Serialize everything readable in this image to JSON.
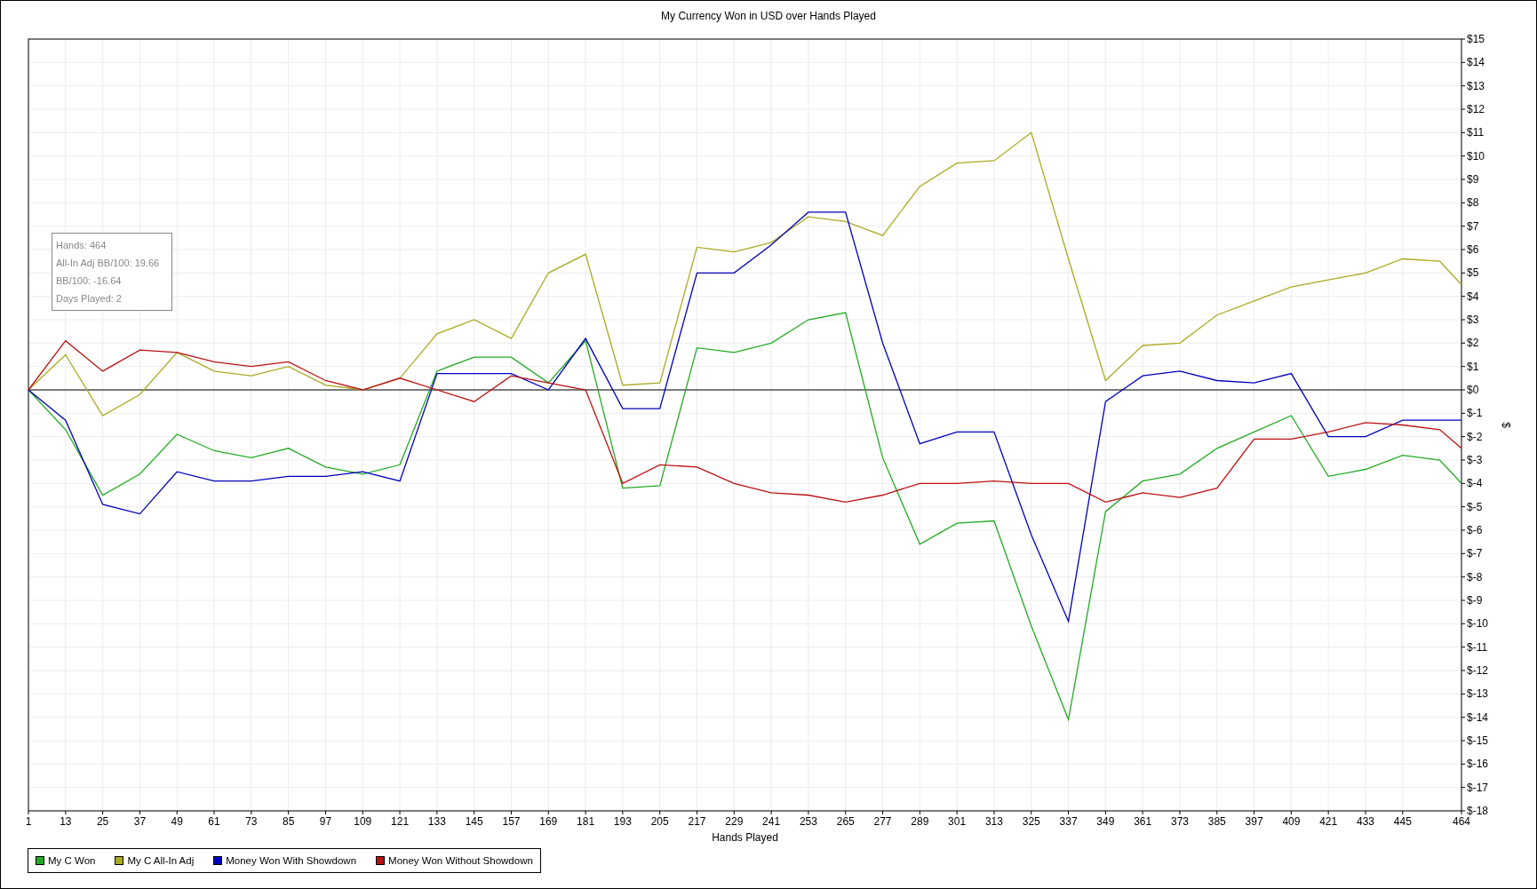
{
  "chart": {
    "stats": [
      "Hands: 464",
      "All-In Adj BB/100: 19.66",
      "BB/100: -16.64",
      "Days Played: 2"
    ],
    "chart_data": {
      "type": "line",
      "title": "My Currency Won in USD over Hands Played",
      "xlabel": "Hands Played",
      "ylabel": "$",
      "x": [
        1,
        13,
        25,
        37,
        49,
        61,
        73,
        85,
        97,
        109,
        121,
        133,
        145,
        157,
        169,
        181,
        193,
        205,
        217,
        229,
        241,
        253,
        265,
        277,
        289,
        301,
        313,
        325,
        337,
        349,
        361,
        373,
        385,
        397,
        409,
        421,
        433,
        445,
        457,
        464
      ],
      "series": [
        {
          "name": "My C Won",
          "color": "#22aa22",
          "values": [
            0,
            -1.7,
            -4.5,
            -3.6,
            -1.9,
            -2.6,
            -2.9,
            -2.5,
            -3.3,
            -3.6,
            -3.2,
            0.8,
            1.4,
            1.4,
            0.3,
            2.1,
            -4.2,
            -4.1,
            1.8,
            1.6,
            2.0,
            3.0,
            3.3,
            -2.9,
            -6.6,
            -5.7,
            -5.6,
            -10.1,
            -14.1,
            -5.2,
            -3.9,
            -3.6,
            -2.5,
            -1.8,
            -1.1,
            -3.7,
            -3.4,
            -2.8,
            -3.0,
            -4.0
          ]
        },
        {
          "name": "My C All-In Adj",
          "color": "#aaaa22",
          "values": [
            0,
            1.5,
            -1.1,
            -0.2,
            1.6,
            0.8,
            0.6,
            1.0,
            0.2,
            0,
            0.5,
            2.4,
            3.0,
            2.2,
            5.0,
            5.8,
            0.2,
            0.3,
            6.1,
            5.9,
            6.3,
            7.4,
            7.2,
            6.6,
            8.7,
            9.7,
            9.8,
            11.0,
            5.6,
            0.4,
            1.9,
            2.0,
            3.2,
            3.8,
            4.4,
            4.7,
            5.0,
            5.6,
            5.5,
            4.5
          ]
        },
        {
          "name": "Money Won With Showdown",
          "color": "#0000bb",
          "values": [
            0,
            -1.3,
            -4.9,
            -5.3,
            -3.5,
            -3.9,
            -3.9,
            -3.7,
            -3.7,
            -3.5,
            -3.9,
            0.7,
            0.7,
            0.7,
            0,
            2.2,
            -0.8,
            -0.8,
            5.0,
            5.0,
            6.2,
            7.6,
            7.6,
            2.0,
            -2.3,
            -1.8,
            -1.8,
            -6.2,
            -9.9,
            -0.5,
            0.6,
            0.8,
            0.4,
            0.3,
            0.7,
            -2.0,
            -2.0,
            -1.3,
            -1.3,
            -1.3
          ]
        },
        {
          "name": "Money Won Without Showdown",
          "color": "#bb1111",
          "values": [
            0,
            2.1,
            0.8,
            1.7,
            1.6,
            1.2,
            1.0,
            1.2,
            0.4,
            0,
            0.5,
            0,
            -0.5,
            0.6,
            0.3,
            0,
            -4.0,
            -3.2,
            -3.3,
            -4.0,
            -4.4,
            -4.5,
            -4.8,
            -4.5,
            -4.0,
            -4.0,
            -3.9,
            -4.0,
            -4.0,
            -4.8,
            -4.4,
            -4.6,
            -4.2,
            -2.1,
            -2.1,
            -1.8,
            -1.4,
            -1.5,
            -1.7,
            -2.5
          ]
        }
      ],
      "xlim": [
        1,
        464
      ],
      "ylim": [
        -18,
        15
      ],
      "grid": true,
      "xticks": [
        1,
        13,
        25,
        37,
        49,
        61,
        73,
        85,
        97,
        109,
        121,
        133,
        145,
        157,
        169,
        181,
        193,
        205,
        217,
        229,
        241,
        253,
        265,
        277,
        289,
        301,
        313,
        325,
        337,
        349,
        361,
        373,
        385,
        397,
        409,
        421,
        433,
        445,
        464
      ],
      "yticks": [
        {
          "value": 15,
          "label": "$15"
        },
        {
          "value": 14,
          "label": "$14"
        },
        {
          "value": 13,
          "label": "$13"
        },
        {
          "value": 12,
          "label": "$12"
        },
        {
          "value": 11,
          "label": "$11"
        },
        {
          "value": 10,
          "label": "$10"
        },
        {
          "value": 9,
          "label": "$9"
        },
        {
          "value": 8,
          "label": "$8"
        },
        {
          "value": 7,
          "label": "$7"
        },
        {
          "value": 6,
          "label": "$6"
        },
        {
          "value": 5,
          "label": "$5"
        },
        {
          "value": 4,
          "label": "$4"
        },
        {
          "value": 3,
          "label": "$3"
        },
        {
          "value": 2,
          "label": "$2"
        },
        {
          "value": 1,
          "label": "$1"
        },
        {
          "value": 0,
          "label": "$0"
        },
        {
          "value": -1,
          "label": "$-1"
        },
        {
          "value": -2,
          "label": "$-2"
        },
        {
          "value": -3,
          "label": "$-3"
        },
        {
          "value": -4,
          "label": "$-4"
        },
        {
          "value": -5,
          "label": "$-5"
        },
        {
          "value": -6,
          "label": "$-6"
        },
        {
          "value": -7,
          "label": "$-7"
        },
        {
          "value": -8,
          "label": "$-8"
        },
        {
          "value": -9,
          "label": "$-9"
        },
        {
          "value": -10,
          "label": "$-10"
        },
        {
          "value": -11,
          "label": "$-11"
        },
        {
          "value": -12,
          "label": "$-12"
        },
        {
          "value": -13,
          "label": "$-13"
        },
        {
          "value": -14,
          "label": "$-14"
        },
        {
          "value": -15,
          "label": "$-15"
        },
        {
          "value": -16,
          "label": "$-16"
        },
        {
          "value": -17,
          "label": "$-17"
        },
        {
          "value": -18,
          "label": "$-18"
        }
      ]
    }
  }
}
